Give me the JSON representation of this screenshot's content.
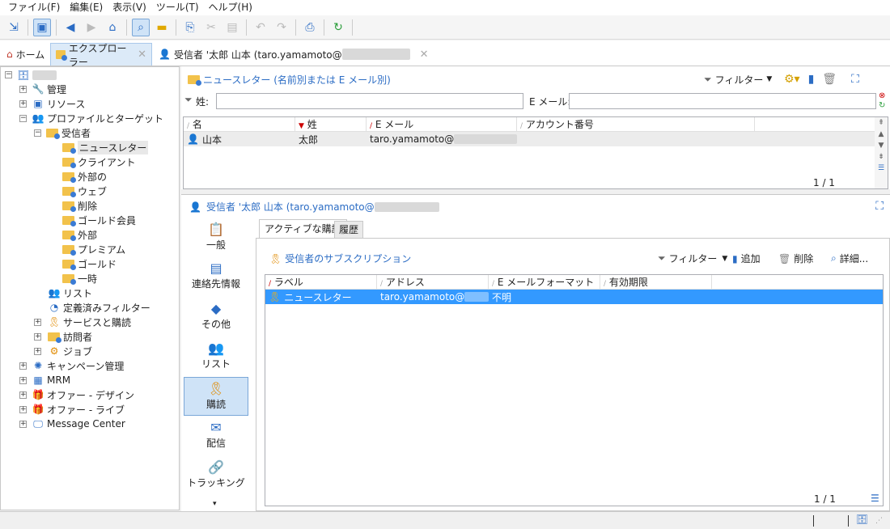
{
  "menu": [
    "ファイル(F)",
    "編集(E)",
    "表示(V)",
    "ツール(T)",
    "ヘルプ(H)"
  ],
  "tabs": {
    "home": "ホーム",
    "explorer": "エクスプローラー",
    "recipient": "受信者 '太郎 山本 (taro.yamamoto@"
  },
  "tree": {
    "root": "",
    "admin": "管理",
    "resources": "リソース",
    "profiles": "プロファイルとターゲット",
    "recipients": "受信者",
    "newsletter": "ニュースレター",
    "client": "クライアント",
    "external": "外部の",
    "web": "ウェブ",
    "deleted": "削除",
    "gold_member": "ゴールド会員",
    "external2": "外部",
    "premium": "プレミアム",
    "gold": "ゴールド",
    "temporary": "一時",
    "list": "リスト",
    "predefined_filters": "定義済みフィルター",
    "services": "サービスと購読",
    "visitors": "訪問者",
    "jobs": "ジョブ",
    "campaign": "キャンペーン管理",
    "mrm": "MRM",
    "offer_design": "オファー - デザイン",
    "offer_live": "オファー - ライブ",
    "message_center": "Message Center"
  },
  "list_panel": {
    "title": "ニュースレター (名前別または E メール別)",
    "filter": "フィルター",
    "last_name_label": "姓:",
    "email_label": "E メール:",
    "columns": [
      "名",
      "姓",
      "E メール",
      "アカウント番号"
    ],
    "rows": [
      {
        "first": "山本",
        "last": "太郎",
        "email": "taro.yamamoto@"
      }
    ],
    "pager": "1 / 1"
  },
  "detail": {
    "title": "受信者 '太郎 山本 (taro.yamamoto@",
    "nav": [
      "一般",
      "連絡先情報",
      "その他",
      "リスト",
      "購読",
      "配信",
      "トラッキング"
    ],
    "sub_tabs": [
      "アクティブな購読",
      "履歴"
    ],
    "sub_title": "受信者のサブスクリプション",
    "filter": "フィルター",
    "add": "追加",
    "delete": "削除",
    "details": "詳細...",
    "columns": [
      "ラベル",
      "アドレス",
      "E メールフォーマット",
      "有効期限"
    ],
    "rows": [
      {
        "label": "ニュースレター",
        "address": "taro.yamamoto@",
        "format": "不明",
        "expiry": ""
      }
    ],
    "pager": "1 / 1"
  },
  "colors": {
    "accent": "#2b6cc4",
    "selection": "#3399ff",
    "folder": "#f2c24b"
  }
}
